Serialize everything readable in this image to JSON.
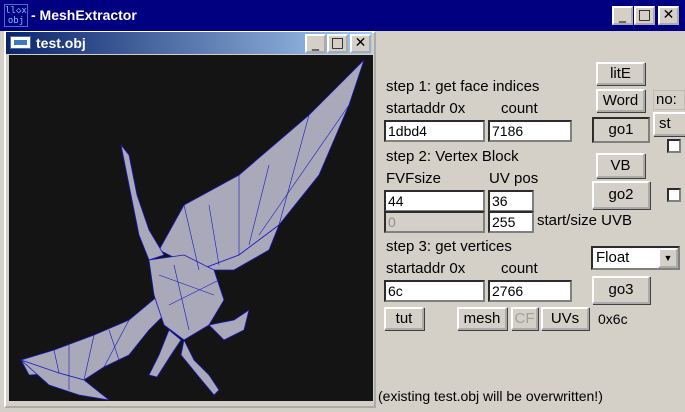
{
  "window": {
    "title": "- MeshExtractor",
    "app_icon_text_top": "ll◇x",
    "app_icon_text_bottom": "obj",
    "minimize": "_",
    "maximize": "□",
    "close": "✕"
  },
  "child_window": {
    "title": "test.obj",
    "minimize": "_",
    "maximize": "□",
    "close": "✕"
  },
  "step1": {
    "heading": "step 1: get face indices",
    "startaddr_label": "startaddr 0x",
    "count_label": "count",
    "startaddr_value": "1dbd4",
    "count_value": "7186"
  },
  "step2": {
    "heading": "step 2: Vertex Block",
    "fvfsize_label": "FVFsize",
    "uvpos_label": "UV pos",
    "fvfsize_value": "44",
    "uvpos_value": "36",
    "start_value": "0",
    "size_value": "255",
    "start_size_label": "start/size UVB"
  },
  "step3": {
    "heading": "step 3: get vertices",
    "startaddr_label": "startaddr 0x",
    "count_label": "count",
    "startaddr_value": "6c",
    "count_value": "2766",
    "format_selected": "Float"
  },
  "buttons": {
    "lite": "litE",
    "word": "Word",
    "go1": "go1",
    "vb": "VB",
    "go2": "go2",
    "go3": "go3",
    "tut": "tut",
    "mesh": "mesh",
    "cf": "CF",
    "uvs": "UVs",
    "no_partial": "no:",
    "st_partial": "st"
  },
  "status": {
    "offset": "0x6c",
    "message": "(existing test.obj will be overwritten!)"
  },
  "icons": {
    "dropdown": "▼"
  },
  "colors": {
    "title_bar": "#000080",
    "child_title_start": "#0a246a",
    "child_title_end": "#a6caf0",
    "viewport_bg": "#141414",
    "mesh_fill": "#a8a8b8",
    "mesh_wire": "#1414c8",
    "face": "#d4d0c8"
  }
}
